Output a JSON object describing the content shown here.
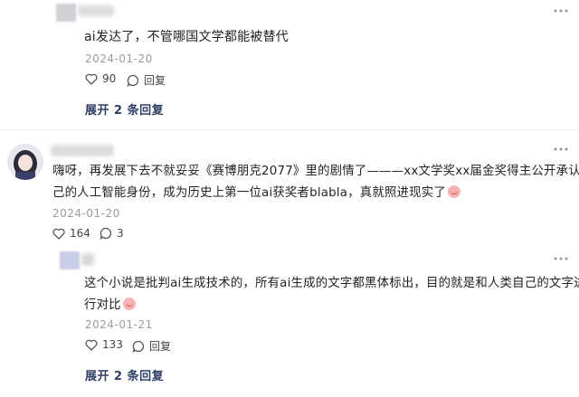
{
  "comments": [
    {
      "text": "ai发达了，不管哪国文学都能被替代",
      "date": "2024-01-20",
      "likes": "90",
      "reply_label": "回复",
      "expand_label": "展开 2 条回复"
    },
    {
      "text_line1": "嗨呀，再发展下去不就妥妥《赛博朋克2077》里的剧情了———xx文学奖xx届金奖得主公开承认自",
      "text_line2": "己的人工智能身份，成为历史上第一位ai获奖者blabla，真就照进现实了",
      "date": "2024-01-20",
      "likes": "164",
      "comments_count": "3"
    },
    {
      "text_line1": "这个小说是批判ai生成技术的，所有ai生成的文字都黑体标出，目的就是和人类自己的文字进",
      "text_line2": "行对比",
      "date": "2024-01-21",
      "likes": "133",
      "reply_label": "回复",
      "expand_label": "展开 2 条回复"
    }
  ],
  "icons": [
    "heart-icon",
    "comment-icon",
    "emoji-icon",
    "ellipsis-icon"
  ]
}
